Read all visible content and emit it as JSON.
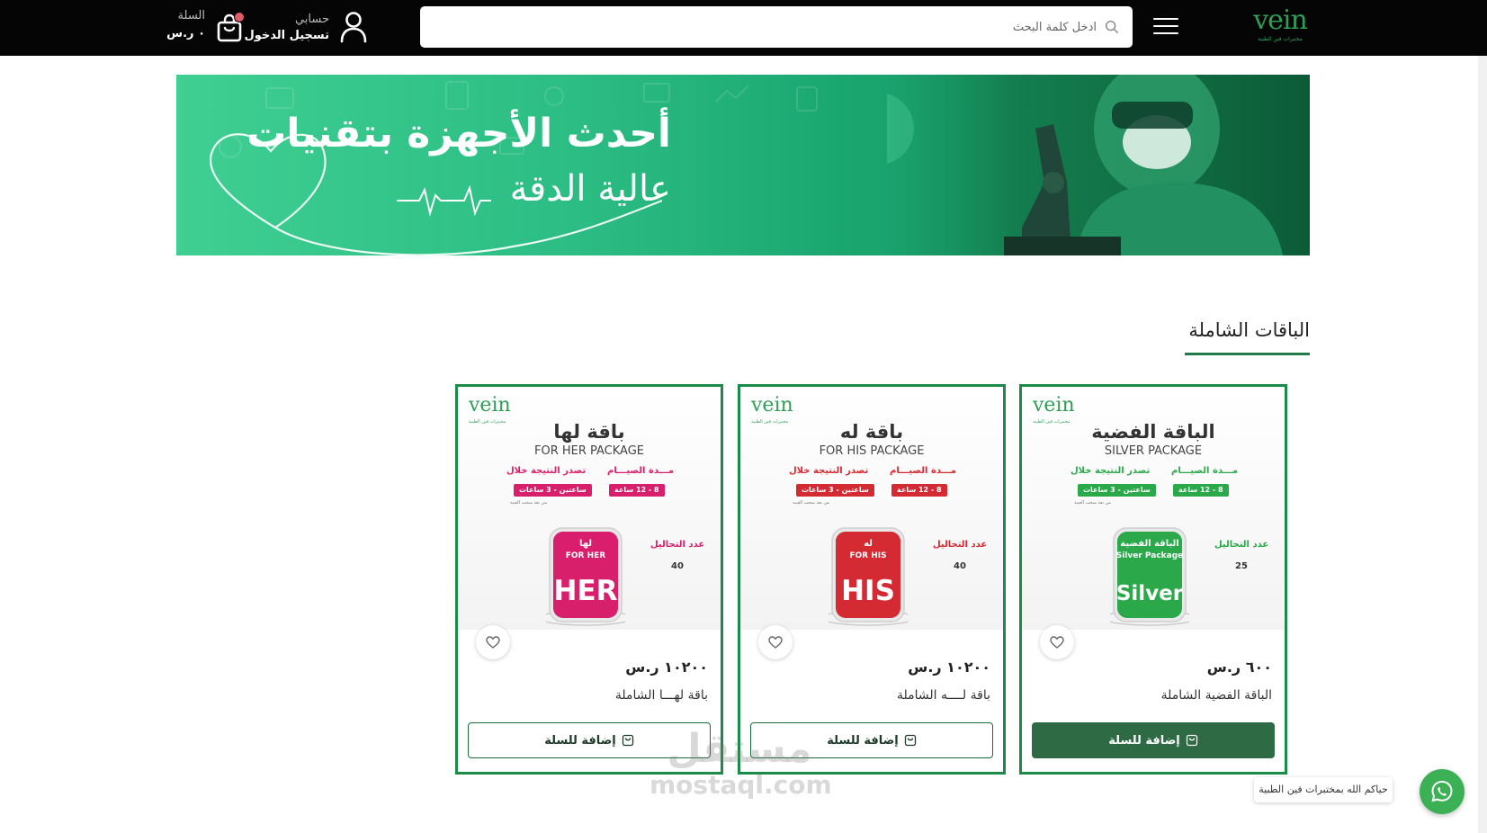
{
  "header": {
    "logo_text": "vein",
    "logo_sub": "مختبرات فين الطبية",
    "search_placeholder": "ادخل كلمة البحث",
    "account_label": "حسابي",
    "login_label": "تسجيل الدخول",
    "cart_label": "السلة",
    "cart_total": "٠ ر.س"
  },
  "banner": {
    "headline": "أحدث الأجهزة بتقنيات",
    "subline": "عالية الدقة"
  },
  "section": {
    "title": "الباقات الشاملة"
  },
  "products": [
    {
      "thumb_title_ar": "الباقة الفضية",
      "thumb_title_en": "SILVER PACKAGE",
      "jar_label_ar": "الباقة الفضية",
      "jar_label_en": "Silver Package",
      "jar_big": "Silver",
      "test_count": "25",
      "price": "٦٠٠ ر.س",
      "name": "الباقة الفضية الشاملة",
      "button": "إضافة للسلة",
      "accent": "#2aa84a"
    },
    {
      "thumb_title_ar": "باقة له",
      "thumb_title_en": "FOR HIS PACKAGE",
      "jar_label_ar": "له",
      "jar_label_en": "FOR HIS",
      "jar_big": "HIS",
      "test_count": "40",
      "price": "١٠٢٠٠ ر.س",
      "name": "باقة لــــه الشاملة",
      "button": "إضافة للسلة",
      "accent": "#d42a33"
    },
    {
      "thumb_title_ar": "باقة لها",
      "thumb_title_en": "FOR HER PACKAGE",
      "jar_label_ar": "لها",
      "jar_label_en": "FOR HER",
      "jar_big": "HER",
      "test_count": "40",
      "price": "١٠٢٠٠ ر.س",
      "name": "باقة لهـــا الشاملة",
      "button": "إضافة للسلة",
      "accent": "#d81f6c"
    }
  ],
  "thumb_common": {
    "fasting_label": "مـــدة الصيـــام",
    "fasting_value": "8 - 12 ساعة",
    "result_label": "تصدر النتيجة خلال",
    "result_value": "ساعتين - 3 ساعات",
    "result_note": "من بعد سحب العينة",
    "count_label": "عدد التحاليل"
  },
  "watermark": {
    "ar": "مستقل",
    "en": "mostaql.com"
  },
  "whatsapp": {
    "bubble": "حياكم الله بمختبرات فين الطبية"
  },
  "colors": {
    "header_bg": "#050505",
    "brand_green": "#1c8a48",
    "button_green": "#2e6b44"
  }
}
